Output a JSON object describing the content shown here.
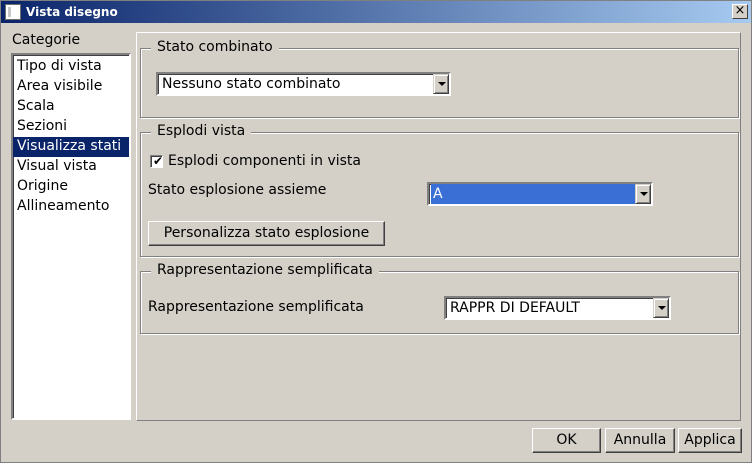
{
  "window": {
    "title": "Vista disegno",
    "close_glyph": "×"
  },
  "categories": {
    "label": "Categorie",
    "items": [
      "Tipo di vista",
      "Area visibile",
      "Scala",
      "Sezioni",
      "Visualizza stati",
      "Visual vista",
      "Origine",
      "Allineamento"
    ],
    "selected": "Visualizza stati"
  },
  "combined_state": {
    "title": "Stato combinato",
    "value": "Nessuno stato combinato"
  },
  "explode": {
    "title": "Esplodi vista",
    "checkbox_label": "Esplodi componenti in vista",
    "checked": true,
    "check_glyph": "✔",
    "state_label": "Stato esplosione assieme",
    "state_value": "A",
    "customize_label": "Personalizza stato esplosione"
  },
  "simplified": {
    "title": "Rappresentazione semplificata",
    "label": "Rappresentazione semplificata",
    "value": "RAPPR DI DEFAULT"
  },
  "buttons": {
    "ok": "OK",
    "cancel": "Annulla",
    "apply": "Applica"
  },
  "colors": {
    "title_start": "#0a246a",
    "title_end": "#a6caf0",
    "selection": "#0a246a",
    "face": "#d4d0c8"
  }
}
